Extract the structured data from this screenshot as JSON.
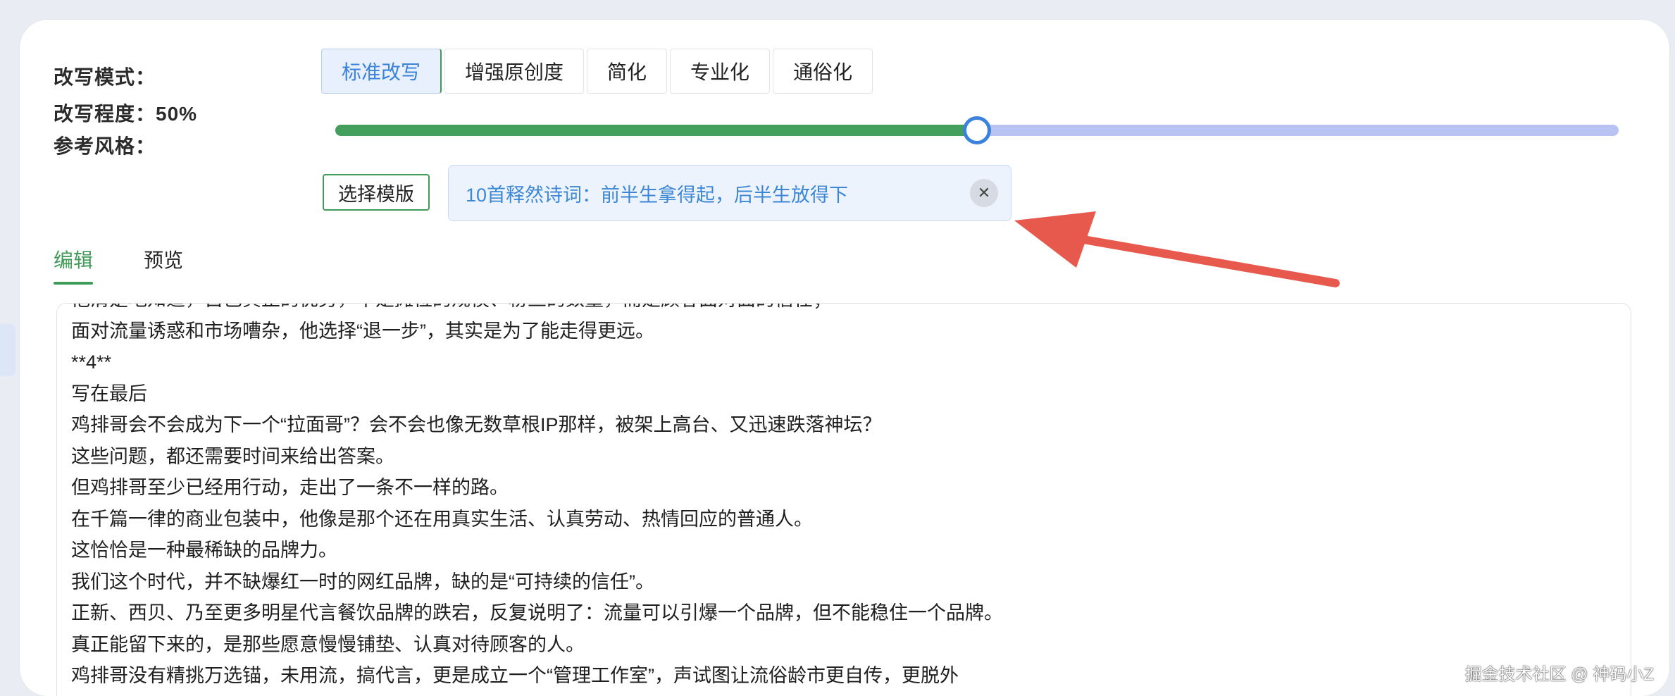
{
  "modes": {
    "label": "改写模式：",
    "options": [
      "标准改写",
      "增强原创度",
      "简化",
      "专业化",
      "通俗化"
    ],
    "selected": "标准改写"
  },
  "degree": {
    "label": "改写程度：50%",
    "value_percent": 50
  },
  "style": {
    "label": "参考风格：",
    "select_template_label": "选择模版",
    "selected_template": "10首释然诗词：前半生拿得起，后半生放得下",
    "remove_icon": "close-icon"
  },
  "tabs": {
    "edit": "编辑",
    "preview": "预览",
    "active": "编辑"
  },
  "editor": {
    "lines": [
      "他清楚地知道，自己真正的优势，不是摊位的规模、粉丝的数量，而是顾客面对面的信任；",
      "面对流量诱惑和市场嘈杂，他选择“退一步”，其实是为了能走得更远。",
      "**4**",
      "写在最后",
      "鸡排哥会不会成为下一个“拉面哥”？会不会也像无数草根IP那样，被架上高台、又迅速跌落神坛？",
      "这些问题，都还需要时间来给出答案。",
      "但鸡排哥至少已经用行动，走出了一条不一样的路。",
      "在千篇一律的商业包装中，他像是那个还在用真实生活、认真劳动、热情回应的普通人。",
      "这恰恰是一种最稀缺的品牌力。",
      "我们这个时代，并不缺爆红一时的网红品牌，缺的是“可持续的信任”。",
      "正新、西贝、乃至更多明星代言餐饮品牌的跌宕，反复说明了：流量可以引爆一个品牌，但不能稳住一个品牌。",
      "真正能留下来的，是那些愿意慢慢铺垫、认真对待顾客的人。",
      "鸡排哥没有精挑万选锚，未用流，搞代言，更是成立一个“管理工作室”，声试图让流俗龄市更自传，更脱外"
    ]
  },
  "watermark": "掘金技术社区 @ 神码小Z",
  "colors": {
    "accent_green": "#3e9b58",
    "accent_blue": "#3c87d6",
    "slider_track": "#b8c3f4",
    "arrow_red": "#e8594d"
  }
}
